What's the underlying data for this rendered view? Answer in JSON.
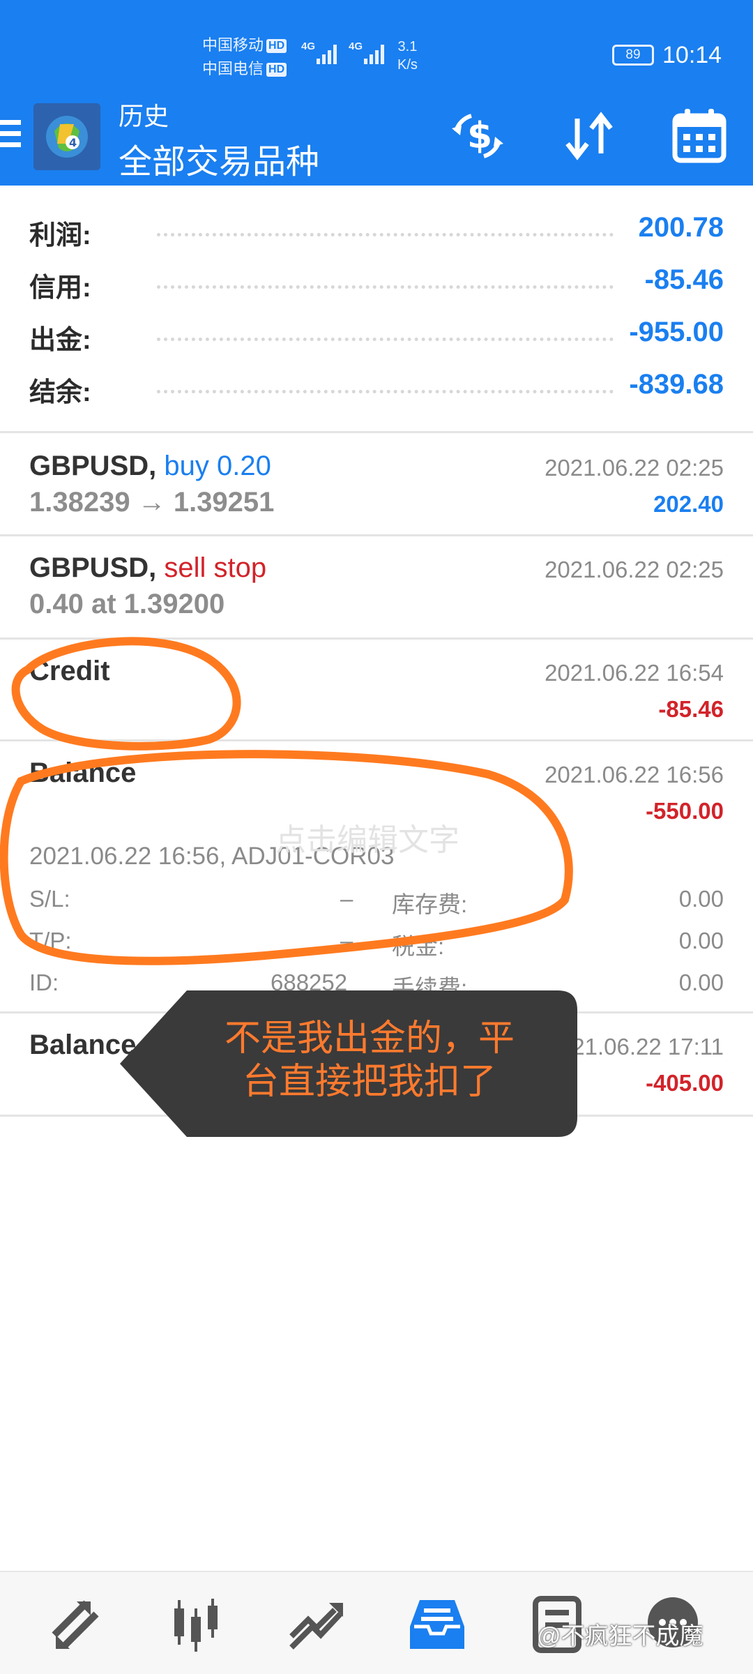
{
  "status_bar": {
    "carrier1": "中国移动",
    "carrier2": "中国电信",
    "hd": "HD",
    "net": "4G",
    "speed_value": "3.1",
    "speed_unit": "K/s",
    "battery": "89",
    "time": "10:14"
  },
  "header": {
    "title_small": "历史",
    "title_big": "全部交易品种",
    "icons": [
      "menu-icon",
      "app-logo",
      "currency-exchange-icon",
      "sort-icon",
      "calendar-icon"
    ]
  },
  "summary": [
    {
      "label": "利润:",
      "value": "200.78"
    },
    {
      "label": "信用:",
      "value": "-85.46"
    },
    {
      "label": "出金:",
      "value": "-955.00"
    },
    {
      "label": "结余:",
      "value": "-839.68"
    }
  ],
  "deals": [
    {
      "symbol": "GBPUSD,",
      "action": "buy 0.20",
      "action_color": "#1a7ff0",
      "detail": "1.38239 → 1.39251",
      "datetime": "2021.06.22 02:25",
      "profit": "202.40",
      "profit_color": "#1a7ff0"
    },
    {
      "symbol": "GBPUSD,",
      "action": "sell stop",
      "action_color": "#d2232a",
      "detail": "0.40 at 1.39200",
      "datetime": "2021.06.22 02:25",
      "profit": "",
      "profit_color": ""
    },
    {
      "symbol": "Credit",
      "action": "",
      "detail": "",
      "datetime": "2021.06.22 16:54",
      "profit": "-85.46",
      "profit_color": "#d2232a"
    },
    {
      "symbol": "Balance",
      "action": "",
      "detail": "",
      "datetime": "2021.06.22 16:56",
      "profit": "-550.00",
      "profit_color": "#d2232a"
    },
    {
      "symbol": "Balance",
      "action": "",
      "detail": "",
      "datetime": "2021.06.22 17:11",
      "profit": "-405.00",
      "profit_color": "#d2232a"
    }
  ],
  "expanded_detail": {
    "comment": "2021.06.22 16:56, ADJ01-COR03",
    "sl_label": "S/L:",
    "sl_value": "–",
    "tp_label": "T/P:",
    "tp_value": "–",
    "id_label": "ID:",
    "id_value": "688252",
    "swap_label": "库存费:",
    "swap_value": "0.00",
    "tax_label": "税金:",
    "tax_value": "0.00",
    "fee_label": "手续费:",
    "fee_value": "0.00"
  },
  "overlay": {
    "edit_placeholder": "点击编辑文字",
    "callout_line1": "不是我出金的，平",
    "callout_line2": "台直接把我扣了",
    "annotation_color": "#ff7a1f",
    "watermark": "@不疯狂不成魔"
  },
  "bottom_nav": [
    "quotes-icon",
    "chart-icon",
    "trade-icon",
    "history-icon",
    "news-icon",
    "chat-icon"
  ],
  "colors": {
    "accent": "#1a7ff0",
    "negative": "#d2232a",
    "header_bg": "#1a7ff0"
  }
}
